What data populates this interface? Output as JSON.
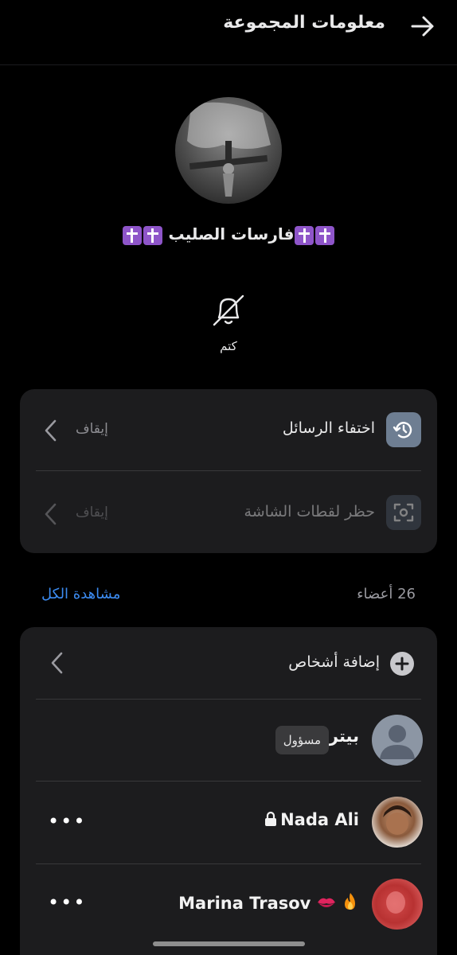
{
  "header": {
    "title": "معلومات المجموعة",
    "back_icon": "arrow-right-icon"
  },
  "group": {
    "name": "فارسات الصليب",
    "emoji": "latin-cross-emoji"
  },
  "mute": {
    "label": "كتم",
    "icon": "bell-off-icon"
  },
  "settings": [
    {
      "label": "اختفاء الرسائل",
      "value": "إيقاف",
      "icon": "timer-history-icon",
      "enabled": true
    },
    {
      "label": "حظر لقطات الشاشة",
      "value": "إيقاف",
      "icon": "screenshot-block-icon",
      "enabled": false
    }
  ],
  "members_section": {
    "count_label": "26 أعضاء",
    "see_all": "مشاهدة الكل",
    "add_label": "إضافة أشخاص",
    "members": [
      {
        "name": "بيتر",
        "badge": "مسؤول"
      },
      {
        "name": "Nada Ali",
        "more": "•••"
      },
      {
        "name": "Marina Trasov",
        "more": "•••"
      }
    ]
  },
  "colors": {
    "accent": "#3c8cf2",
    "card": "#1c1c1e",
    "background": "#000000"
  }
}
